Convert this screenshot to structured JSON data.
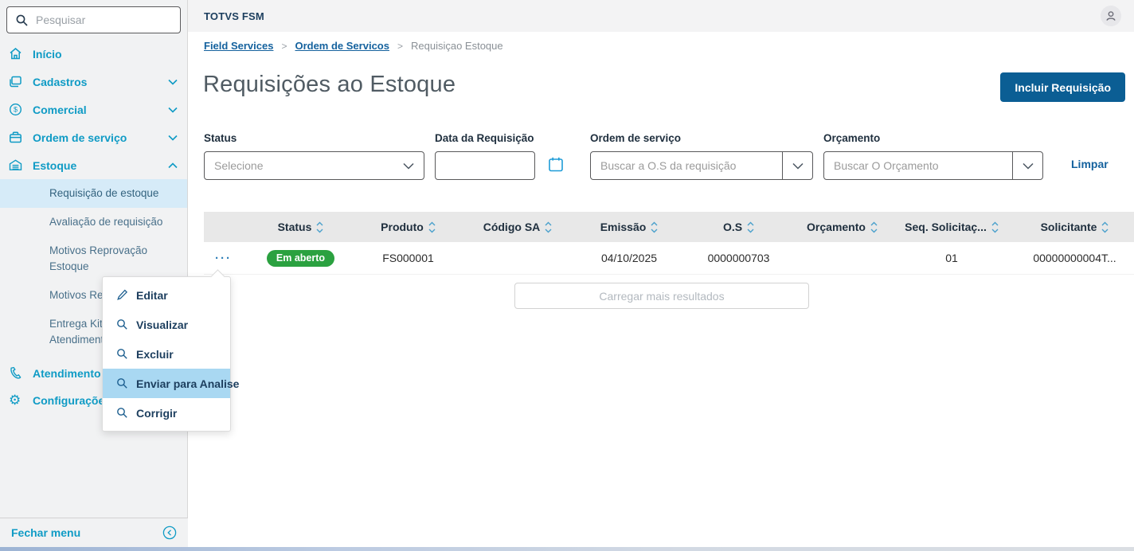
{
  "topbar": {
    "brand": "TOTVS FSM"
  },
  "sidebar": {
    "search_placeholder": "Pesquisar",
    "items": [
      {
        "label": "Início",
        "icon": "home"
      },
      {
        "label": "Cadastros",
        "icon": "cards",
        "chevron": "down"
      },
      {
        "label": "Comercial",
        "icon": "dollar-circle",
        "chevron": "down"
      },
      {
        "label": "Ordem de serviço",
        "icon": "briefcase",
        "chevron": "down"
      },
      {
        "label": "Estoque",
        "icon": "warehouse",
        "chevron": "up"
      }
    ],
    "submenu": [
      {
        "label": "Requisição de estoque",
        "selected": true
      },
      {
        "label": "Avaliação de requisição"
      },
      {
        "label": "Motivos Reprovação Estoque"
      },
      {
        "label": "Motivos Re"
      },
      {
        "label": "Entrega Kit Atendimento"
      }
    ],
    "bottom_items": [
      {
        "label": "Atendimento",
        "icon": "phone"
      },
      {
        "label": "Configurações",
        "icon": "gear"
      }
    ],
    "footer_label": "Fechar menu"
  },
  "breadcrumb": {
    "level1": "Field Services",
    "separator": ">",
    "level2": "Ordem de Servicos",
    "level3": "Requisiçao Estoque"
  },
  "page": {
    "title": "Requisições ao Estoque",
    "add_button_label": "Incluir Requisição"
  },
  "filters": {
    "status_label": "Status",
    "status_placeholder": "Selecione",
    "date_label": "Data da Requisição",
    "date_value": "",
    "os_label": "Ordem de serviço",
    "os_placeholder": "Buscar a O.S da requisição",
    "budget_label": "Orçamento",
    "budget_placeholder": "Buscar O Orçamento",
    "clear_label": "Limpar"
  },
  "table": {
    "columns": [
      "Status",
      "Produto",
      "Código SA",
      "Emissão",
      "O.S",
      "Orçamento",
      "Seq. Solicitaç...",
      "Solicitante"
    ],
    "row": {
      "status_badge": "Em aberto",
      "produto": "FS000001",
      "codigo_sa": "",
      "emissao": "04/10/2025",
      "os": "0000000703",
      "orcamento": "",
      "seq_solicitacao": "01",
      "solicitante": "00000000004T...",
      "actions_trigger": "···"
    },
    "load_more_label": "Carregar mais resultados"
  },
  "context_menu": {
    "items": [
      {
        "label": "Editar",
        "icon": "pencil"
      },
      {
        "label": "Visualizar",
        "icon": "magnifier"
      },
      {
        "label": "Excluir",
        "icon": "magnifier"
      },
      {
        "label": "Enviar para Analise",
        "icon": "magnifier",
        "highlighted": true
      },
      {
        "label": "Corrigir",
        "icon": "magnifier"
      }
    ]
  },
  "colors": {
    "accent_teal": "#0f9bc5",
    "brand_navy": "#1c3e5e",
    "primary_button_blue": "#0b5e94",
    "badge_green": "#2ba140",
    "menu_highlight_blue": "#a9d8f2",
    "selected_item_bg": "#d6ebf8"
  }
}
